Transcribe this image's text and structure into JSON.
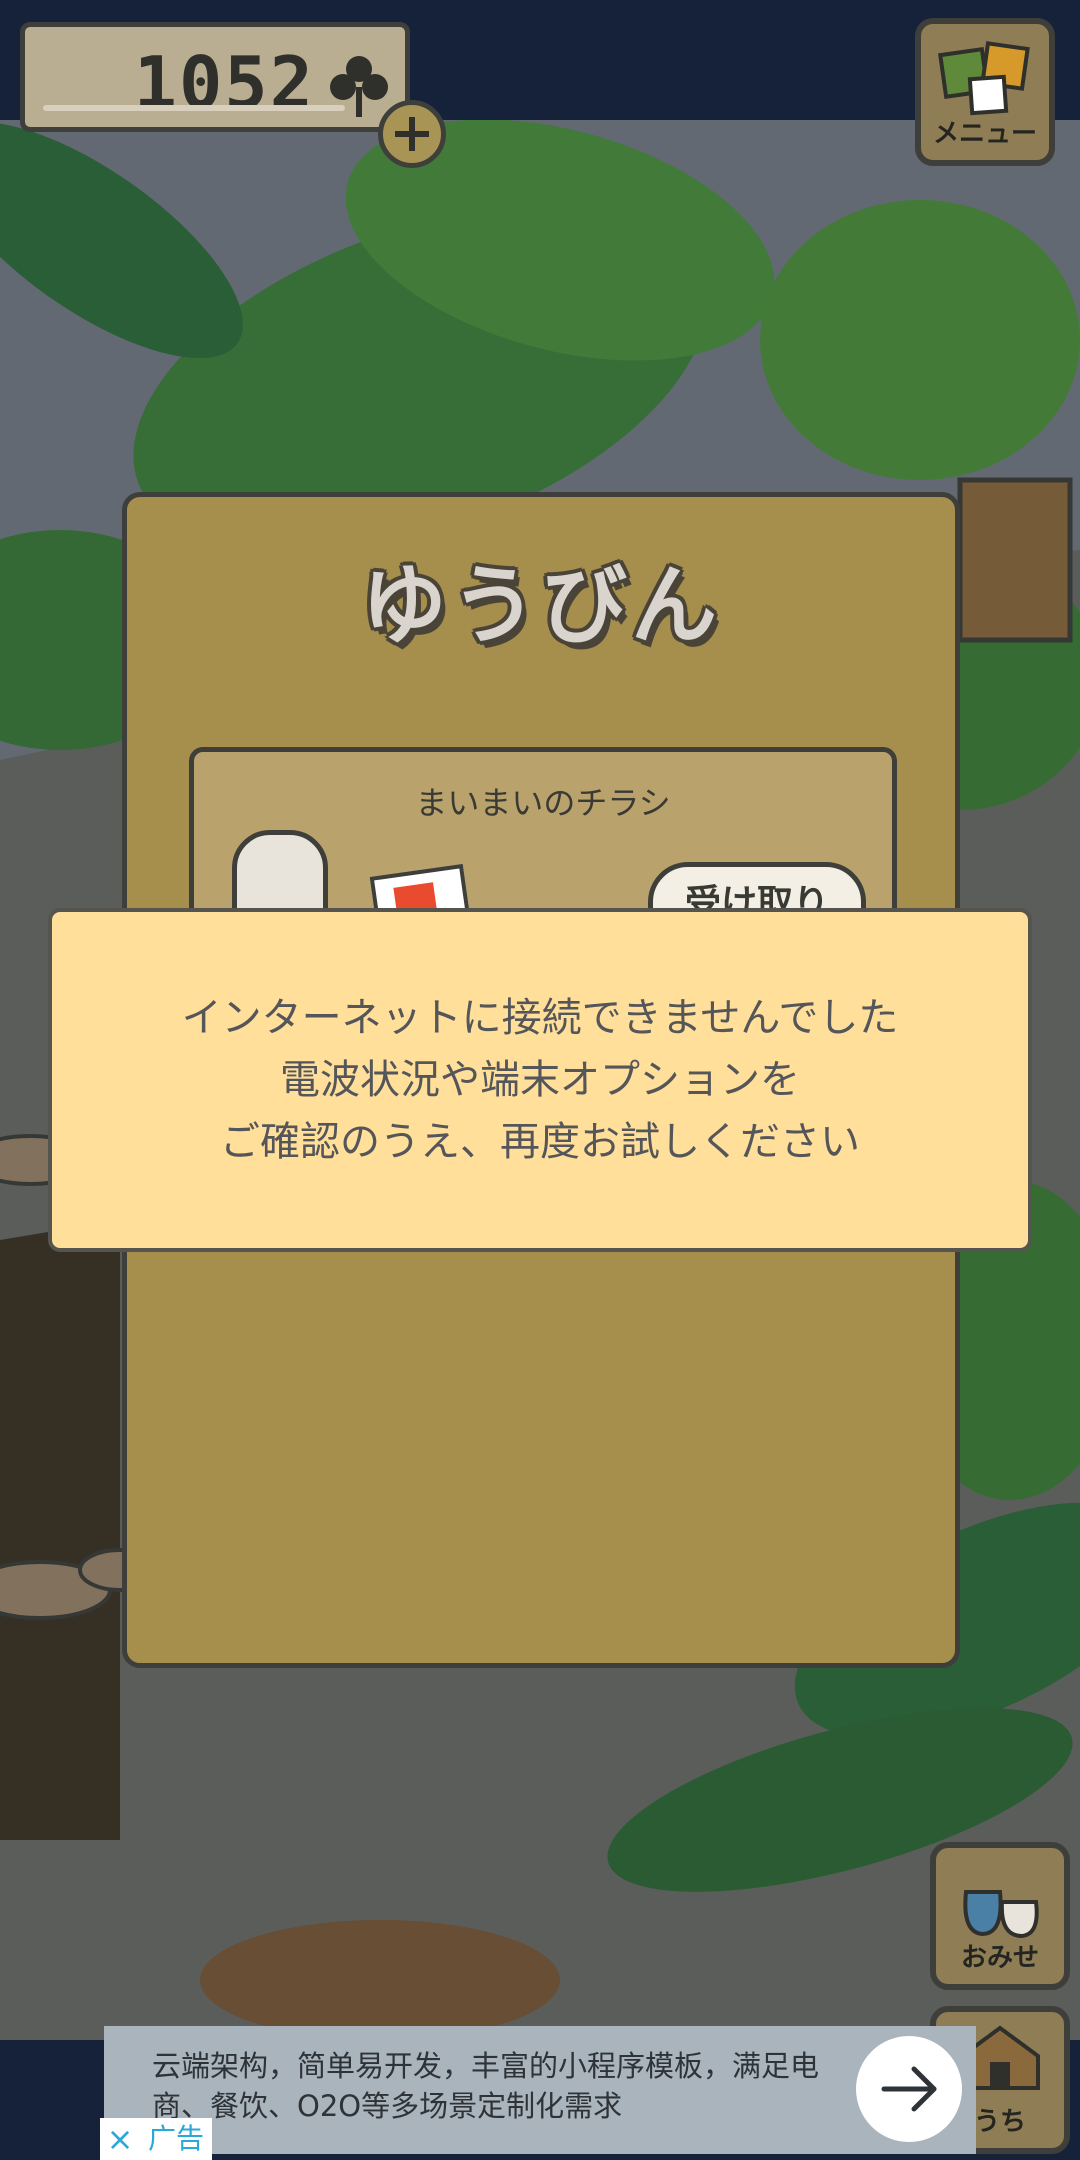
{
  "hud": {
    "clover_count": "1052",
    "menu_label": "メニュー",
    "shop_label": "おみせ",
    "home_label": "うち"
  },
  "mail_panel": {
    "title": "ゆうびん",
    "item_title": "まいまいのチラシ",
    "receive_button": "受け取り"
  },
  "dialog": {
    "line1": "インターネットに接続できませんでした",
    "line2": "電波状況や端末オプションを",
    "line3": "ご確認のうえ、再度お試しください"
  },
  "ad": {
    "text": "云端架构，简单易开发，丰富的小程序模板，满足电商、餐饮、O2O等多场景定制化需求",
    "tag": "广告",
    "close_icon": "×"
  },
  "colors": {
    "panel": "#a68e4d",
    "dialog": "#ffdf9a",
    "background": "#16233f"
  }
}
